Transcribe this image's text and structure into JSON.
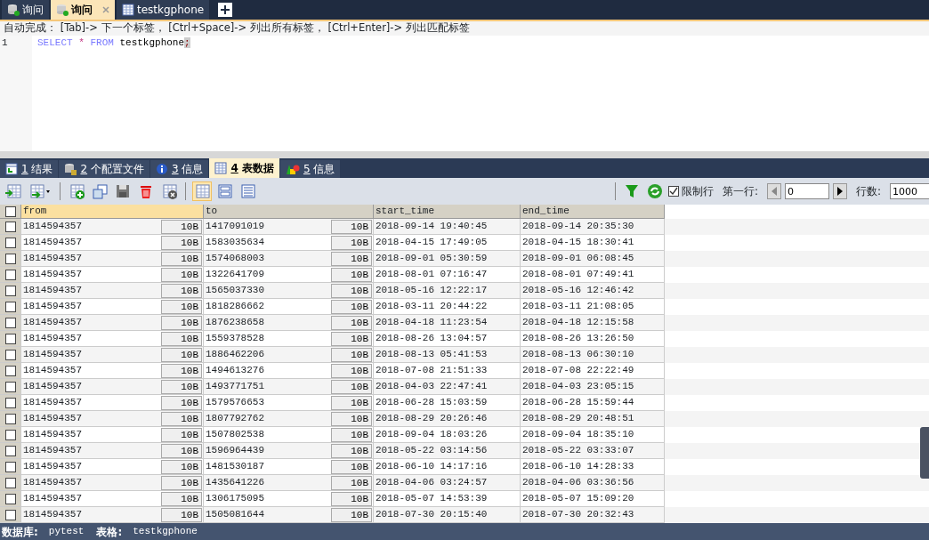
{
  "editor_tabs": [
    {
      "label": "询问",
      "selected": false
    },
    {
      "label": "询问",
      "selected": true
    },
    {
      "label": "testkgphone",
      "selected": false
    }
  ],
  "hint": "自动完成： [Tab]-> 下一个标签， [Ctrl+Space]-> 列出所有标签， [Ctrl+Enter]-> 列出匹配标签",
  "editor": {
    "lines": [
      {
        "number": "1",
        "tokens": [
          {
            "kind": "keyword",
            "text": "SELECT"
          },
          {
            "kind": "operator",
            "text": "*"
          },
          {
            "kind": "keyword",
            "text": "FROM"
          },
          {
            "kind": "identifier",
            "text": "testkgphone"
          },
          {
            "kind": "match",
            "text": ";"
          }
        ]
      }
    ]
  },
  "result_tabs": [
    {
      "key": "1",
      "label": "结果",
      "selected": false
    },
    {
      "key": "2",
      "label": "个配置文件",
      "selected": false
    },
    {
      "key": "3",
      "label": "信息",
      "selected": false
    },
    {
      "key": "4",
      "label": "表数据",
      "selected": true
    },
    {
      "key": "5",
      "label": "信息",
      "selected": false
    }
  ],
  "view_modes": [
    {
      "selected": true
    },
    {
      "selected": false
    },
    {
      "selected": false
    }
  ],
  "limit": {
    "label": "限制行",
    "checked": true,
    "first_row_label": "第一行:",
    "first_row": "0",
    "count_label": "行数:",
    "count": "1000"
  },
  "table": {
    "select_all_checked": false,
    "columns": [
      {
        "label": "from",
        "selected": true
      },
      {
        "label": "to",
        "selected": false
      },
      {
        "label": "start_time",
        "selected": false
      },
      {
        "label": "end_time",
        "selected": false
      }
    ],
    "rows": [
      {
        "checked": false,
        "cells": [
          {
            "text": "1814594357",
            "blob": "10B"
          },
          {
            "text": "1417091019",
            "blob": "10B"
          },
          {
            "text": "2018-09-14 19:40:45"
          },
          {
            "text": "2018-09-14 20:35:30"
          }
        ]
      },
      {
        "checked": false,
        "cells": [
          {
            "text": "1814594357",
            "blob": "10B"
          },
          {
            "text": "1583035634",
            "blob": "10B"
          },
          {
            "text": "2018-04-15 17:49:05"
          },
          {
            "text": "2018-04-15 18:30:41"
          }
        ]
      },
      {
        "checked": false,
        "cells": [
          {
            "text": "1814594357",
            "blob": "10B"
          },
          {
            "text": "1574068003",
            "blob": "10B"
          },
          {
            "text": "2018-09-01 05:30:59"
          },
          {
            "text": "2018-09-01 06:08:45"
          }
        ]
      },
      {
        "checked": false,
        "cells": [
          {
            "text": "1814594357",
            "blob": "10B"
          },
          {
            "text": "1322641709",
            "blob": "10B"
          },
          {
            "text": "2018-08-01 07:16:47"
          },
          {
            "text": "2018-08-01 07:49:41"
          }
        ]
      },
      {
        "checked": false,
        "cells": [
          {
            "text": "1814594357",
            "blob": "10B"
          },
          {
            "text": "1565037330",
            "blob": "10B"
          },
          {
            "text": "2018-05-16 12:22:17"
          },
          {
            "text": "2018-05-16 12:46:42"
          }
        ]
      },
      {
        "checked": false,
        "cells": [
          {
            "text": "1814594357",
            "blob": "10B"
          },
          {
            "text": "1818286662",
            "blob": "10B"
          },
          {
            "text": "2018-03-11 20:44:22"
          },
          {
            "text": "2018-03-11 21:08:05"
          }
        ]
      },
      {
        "checked": false,
        "cells": [
          {
            "text": "1814594357",
            "blob": "10B"
          },
          {
            "text": "1876238658",
            "blob": "10B"
          },
          {
            "text": "2018-04-18 11:23:54"
          },
          {
            "text": "2018-04-18 12:15:58"
          }
        ]
      },
      {
        "checked": false,
        "cells": [
          {
            "text": "1814594357",
            "blob": "10B"
          },
          {
            "text": "1559378528",
            "blob": "10B"
          },
          {
            "text": "2018-08-26 13:04:57"
          },
          {
            "text": "2018-08-26 13:26:50"
          }
        ]
      },
      {
        "checked": false,
        "cells": [
          {
            "text": "1814594357",
            "blob": "10B"
          },
          {
            "text": "1886462206",
            "blob": "10B"
          },
          {
            "text": "2018-08-13 05:41:53"
          },
          {
            "text": "2018-08-13 06:30:10"
          }
        ]
      },
      {
        "checked": false,
        "cells": [
          {
            "text": "1814594357",
            "blob": "10B"
          },
          {
            "text": "1494613276",
            "blob": "10B"
          },
          {
            "text": "2018-07-08 21:51:33"
          },
          {
            "text": "2018-07-08 22:22:49"
          }
        ]
      },
      {
        "checked": false,
        "cells": [
          {
            "text": "1814594357",
            "blob": "10B"
          },
          {
            "text": "1493771751",
            "blob": "10B"
          },
          {
            "text": "2018-04-03 22:47:41"
          },
          {
            "text": "2018-04-03 23:05:15"
          }
        ]
      },
      {
        "checked": false,
        "cells": [
          {
            "text": "1814594357",
            "blob": "10B"
          },
          {
            "text": "1579576653",
            "blob": "10B"
          },
          {
            "text": "2018-06-28 15:03:59"
          },
          {
            "text": "2018-06-28 15:59:44"
          }
        ]
      },
      {
        "checked": false,
        "cells": [
          {
            "text": "1814594357",
            "blob": "10B"
          },
          {
            "text": "1807792762",
            "blob": "10B"
          },
          {
            "text": "2018-08-29 20:26:46"
          },
          {
            "text": "2018-08-29 20:48:51"
          }
        ]
      },
      {
        "checked": false,
        "cells": [
          {
            "text": "1814594357",
            "blob": "10B"
          },
          {
            "text": "1507802538",
            "blob": "10B"
          },
          {
            "text": "2018-09-04 18:03:26"
          },
          {
            "text": "2018-09-04 18:35:10"
          }
        ]
      },
      {
        "checked": false,
        "cells": [
          {
            "text": "1814594357",
            "blob": "10B"
          },
          {
            "text": "1596964439",
            "blob": "10B"
          },
          {
            "text": "2018-05-22 03:14:56"
          },
          {
            "text": "2018-05-22 03:33:07"
          }
        ]
      },
      {
        "checked": false,
        "cells": [
          {
            "text": "1814594357",
            "blob": "10B"
          },
          {
            "text": "1481530187",
            "blob": "10B"
          },
          {
            "text": "2018-06-10 14:17:16"
          },
          {
            "text": "2018-06-10 14:28:33"
          }
        ]
      },
      {
        "checked": false,
        "cells": [
          {
            "text": "1814594357",
            "blob": "10B"
          },
          {
            "text": "1435641226",
            "blob": "10B"
          },
          {
            "text": "2018-04-06 03:24:57"
          },
          {
            "text": "2018-04-06 03:36:56"
          }
        ]
      },
      {
        "checked": false,
        "cells": [
          {
            "text": "1814594357",
            "blob": "10B"
          },
          {
            "text": "1306175095",
            "blob": "10B"
          },
          {
            "text": "2018-05-07 14:53:39"
          },
          {
            "text": "2018-05-07 15:09:20"
          }
        ]
      },
      {
        "checked": false,
        "cells": [
          {
            "text": "1814594357",
            "blob": "10B"
          },
          {
            "text": "1505081644",
            "blob": "10B"
          },
          {
            "text": "2018-07-30 20:15:40"
          },
          {
            "text": "2018-07-30 20:32:43"
          }
        ]
      }
    ]
  },
  "status_bar": [
    {
      "label": "数据库:",
      "value": "pytest"
    },
    {
      "label": "表格:",
      "value": "testkgphone"
    }
  ]
}
